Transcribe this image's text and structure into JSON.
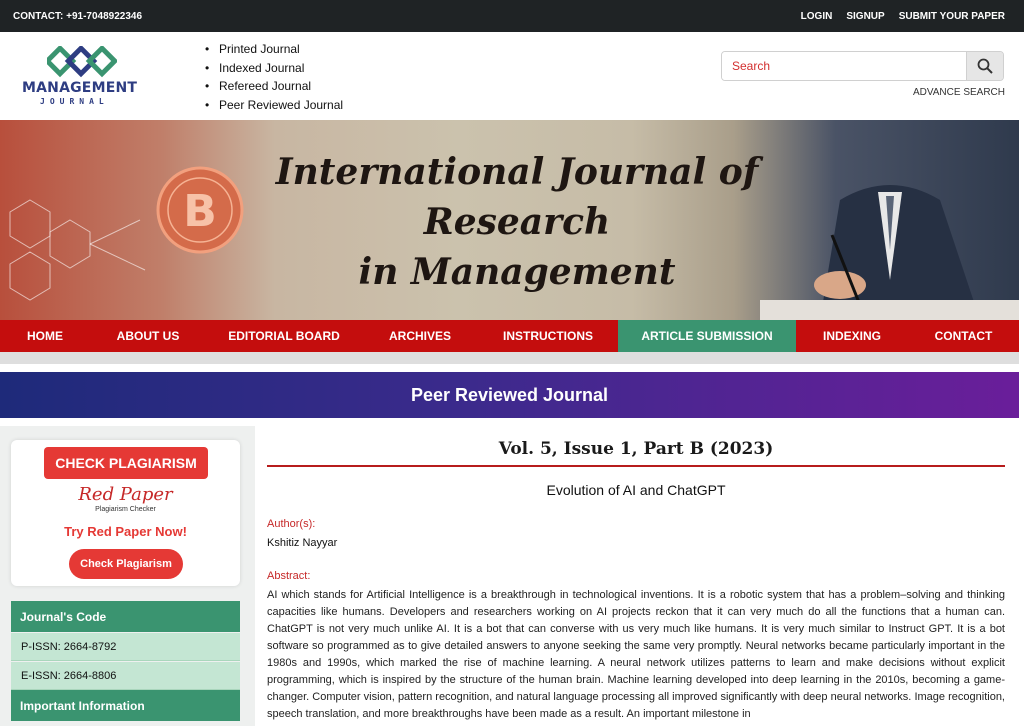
{
  "topbar": {
    "contact": "CONTACT: +91-7048922346",
    "links": [
      "LOGIN",
      "SIGNUP",
      "SUBMIT YOUR PAPER"
    ]
  },
  "logo": {
    "name": "MANAGEMENT",
    "sub": "JOURNAL"
  },
  "features": [
    "Printed Journal",
    "Indexed Journal",
    "Refereed Journal",
    "Peer Reviewed Journal"
  ],
  "search": {
    "placeholder": "Search",
    "advance": "ADVANCE SEARCH"
  },
  "banner": {
    "line1": "International Journal of",
    "line2": "Research",
    "line3": "in Management"
  },
  "nav": {
    "items": [
      "HOME",
      "ABOUT US",
      "EDITORIAL BOARD",
      "ARCHIVES",
      "INSTRUCTIONS",
      "ARTICLE SUBMISSION",
      "INDEXING",
      "CONTACT"
    ],
    "active": "ARTICLE SUBMISSION"
  },
  "band": {
    "label": "Peer Reviewed Journal"
  },
  "sidebar": {
    "check_plagiarism": "CHECK PLAGIARISM",
    "redpaper": "Red Paper",
    "redpaper_sub": "Plagiarism Checker",
    "try": "Try Red Paper Now!",
    "check_btn": "Check Plagiarism",
    "journal_code_title": "Journal's Code",
    "pissn": "P-ISSN: 2664-8792",
    "eissn": "E-ISSN: 2664-8806",
    "important_title": "Important Information"
  },
  "article": {
    "volume": "Vol. 5, Issue 1, Part B (2023)",
    "title": "Evolution of AI and ChatGPT",
    "authors_label": "Author(s):",
    "authors": "Kshitiz Nayyar",
    "abstract_label": "Abstract:",
    "abstract": "AI which stands for Artificial Intelligence is a breakthrough in technological inventions. It is a robotic system that has a problem–solving and thinking capacities like humans. Developers and researchers working on AI projects reckon that it can very much do all the functions that a human can. ChatGPT is not very much unlike AI. It is a bot that can converse with us very much like humans. It is very much similar to Instruct GPT. It is a bot software so programmed as to give detailed answers to anyone seeking the same very promptly. Neural networks became particularly important in the 1980s and 1990s, which marked the rise of machine learning. A neural network utilizes patterns to learn and make decisions without explicit programming, which is inspired by the structure of the human brain. Machine learning developed into deep learning in the 2010s, becoming a game-changer. Computer vision, pattern recognition, and natural language processing all improved significantly with deep neural networks. Image recognition, speech translation, and more breakthroughs have been made as a result. An important milestone in"
  },
  "colors": {
    "nav_red": "#c40d0d",
    "accent_green": "#3a9470",
    "button_red": "#e53935"
  }
}
